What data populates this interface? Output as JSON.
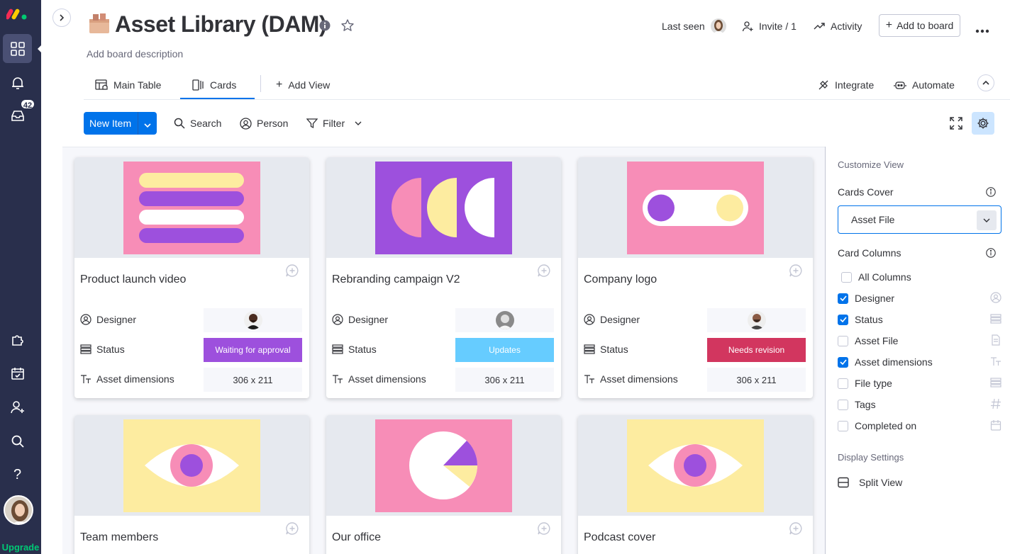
{
  "rail": {
    "upgrade_label": "Upgrade",
    "inbox_count": "42",
    "items": [
      "logo-icon",
      "home-icon",
      "bell-icon",
      "inbox-icon",
      "puzzle-icon",
      "calendar-check-icon",
      "add-person-icon",
      "search-icon",
      "help-icon",
      "avatar"
    ]
  },
  "header": {
    "title": "Asset Library (DAM)",
    "description": "Add board description",
    "last_seen": "Last seen",
    "invite": "Invite / 1",
    "activity": "Activity",
    "add_to_board": "Add to board"
  },
  "tabs": {
    "main_table": "Main Table",
    "cards": "Cards",
    "add_view": "Add View",
    "integrate": "Integrate",
    "automate": "Automate",
    "active": "Cards"
  },
  "toolbar": {
    "new_item": "New Item",
    "search": "Search",
    "person": "Person",
    "filter": "Filter"
  },
  "field_labels": {
    "designer": "Designer",
    "status": "Status",
    "asset_dimensions": "Asset dimensions"
  },
  "cards": [
    {
      "title": "Product launch video",
      "status": "Waiting for approval",
      "status_color": "#9d50dd",
      "dimensions": "306 x 211",
      "cover": "stripes"
    },
    {
      "title": "Rebranding campaign V2",
      "status": "Updates",
      "status_color": "#66ccff",
      "dimensions": "306 x 211",
      "cover": "shapes"
    },
    {
      "title": "Company logo",
      "status": "Needs revision",
      "status_color": "#d2365f",
      "dimensions": "306 x 211",
      "cover": "toggle"
    },
    {
      "title": "Team members",
      "cover": "eye-yellow"
    },
    {
      "title": "Our office",
      "cover": "pie"
    },
    {
      "title": "Podcast cover",
      "cover": "eye-yellow"
    }
  ],
  "panel": {
    "customize_view": "Customize View",
    "cards_cover": "Cards Cover",
    "cover_value": "Asset File",
    "card_columns": "Card Columns",
    "columns": [
      {
        "label": "All Columns",
        "checked": false
      },
      {
        "label": "Designer",
        "checked": true
      },
      {
        "label": "Status",
        "checked": true
      },
      {
        "label": "Asset File",
        "checked": false
      },
      {
        "label": "Asset dimensions",
        "checked": true
      },
      {
        "label": "File type",
        "checked": false
      },
      {
        "label": "Tags",
        "checked": false
      },
      {
        "label": "Completed on",
        "checked": false
      }
    ],
    "display_settings": "Display Settings",
    "split_view": "Split View"
  },
  "colors": {
    "rail": "#292f4c",
    "primary": "#0073ea",
    "cover_pink": "#f78db7",
    "cover_purple": "#9d50dd",
    "cover_yellow": "#fdeca0"
  }
}
